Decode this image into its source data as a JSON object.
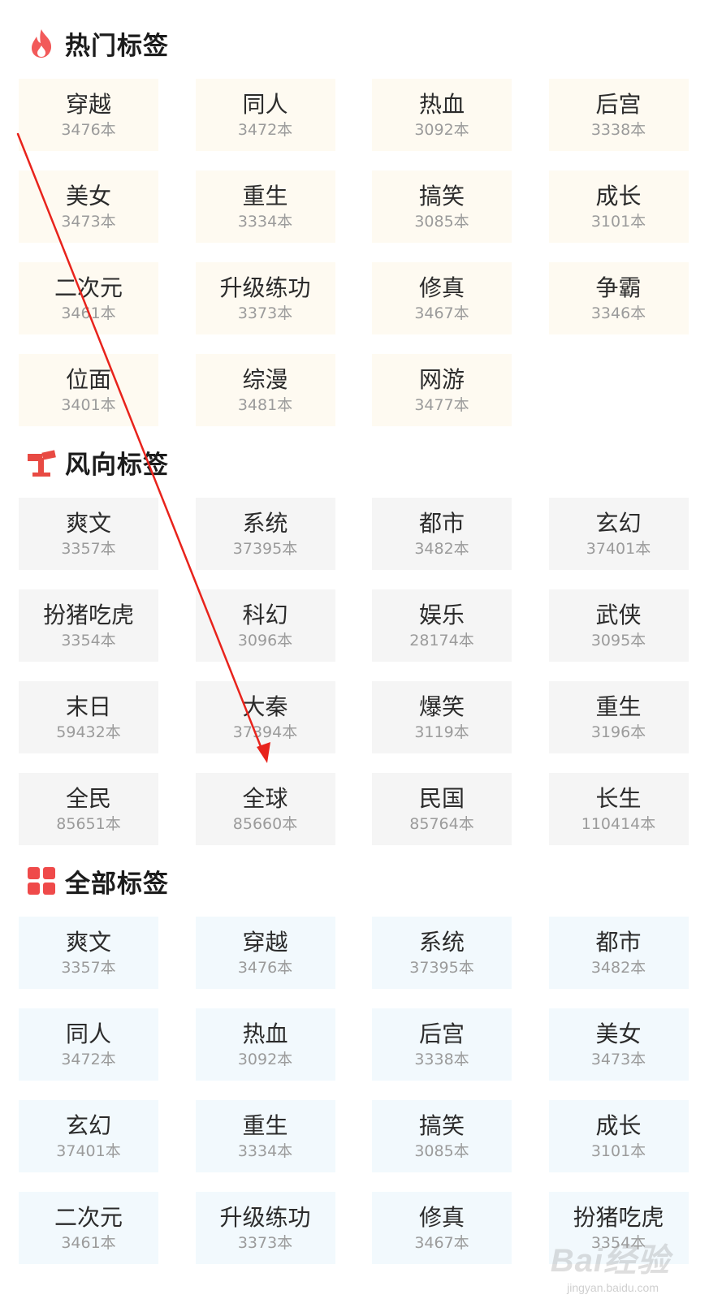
{
  "hot": {
    "title": "热门标签",
    "tags": [
      {
        "name": "穿越",
        "count": "3476本"
      },
      {
        "name": "同人",
        "count": "3472本"
      },
      {
        "name": "热血",
        "count": "3092本"
      },
      {
        "name": "后宫",
        "count": "3338本"
      },
      {
        "name": "美女",
        "count": "3473本"
      },
      {
        "name": "重生",
        "count": "3334本"
      },
      {
        "name": "搞笑",
        "count": "3085本"
      },
      {
        "name": "成长",
        "count": "3101本"
      },
      {
        "name": "二次元",
        "count": "3461本"
      },
      {
        "name": "升级练功",
        "count": "3373本"
      },
      {
        "name": "修真",
        "count": "3467本"
      },
      {
        "name": "争霸",
        "count": "3346本"
      },
      {
        "name": "位面",
        "count": "3401本"
      },
      {
        "name": "综漫",
        "count": "3481本"
      },
      {
        "name": "网游",
        "count": "3477本"
      }
    ]
  },
  "trend": {
    "title": "风向标签",
    "tags": [
      {
        "name": "爽文",
        "count": "3357本"
      },
      {
        "name": "系统",
        "count": "37395本"
      },
      {
        "name": "都市",
        "count": "3482本"
      },
      {
        "name": "玄幻",
        "count": "37401本"
      },
      {
        "name": "扮猪吃虎",
        "count": "3354本"
      },
      {
        "name": "科幻",
        "count": "3096本"
      },
      {
        "name": "娱乐",
        "count": "28174本"
      },
      {
        "name": "武侠",
        "count": "3095本"
      },
      {
        "name": "末日",
        "count": "59432本"
      },
      {
        "name": "大秦",
        "count": "37394本"
      },
      {
        "name": "爆笑",
        "count": "3119本"
      },
      {
        "name": "重生",
        "count": "3196本"
      },
      {
        "name": "全民",
        "count": "85651本"
      },
      {
        "name": "全球",
        "count": "85660本"
      },
      {
        "name": "民国",
        "count": "85764本"
      },
      {
        "name": "长生",
        "count": "110414本"
      }
    ]
  },
  "all": {
    "title": "全部标签",
    "tags": [
      {
        "name": "爽文",
        "count": "3357本"
      },
      {
        "name": "穿越",
        "count": "3476本"
      },
      {
        "name": "系统",
        "count": "37395本"
      },
      {
        "name": "都市",
        "count": "3482本"
      },
      {
        "name": "同人",
        "count": "3472本"
      },
      {
        "name": "热血",
        "count": "3092本"
      },
      {
        "name": "后宫",
        "count": "3338本"
      },
      {
        "name": "美女",
        "count": "3473本"
      },
      {
        "name": "玄幻",
        "count": "37401本"
      },
      {
        "name": "重生",
        "count": "3334本"
      },
      {
        "name": "搞笑",
        "count": "3085本"
      },
      {
        "name": "成长",
        "count": "3101本"
      },
      {
        "name": "二次元",
        "count": "3461本"
      },
      {
        "name": "升级练功",
        "count": "3373本"
      },
      {
        "name": "修真",
        "count": "3467本"
      },
      {
        "name": "扮猪吃虎",
        "count": "3354本"
      }
    ]
  },
  "watermark": {
    "text": "Bai经验",
    "sub": "jingyan.baidu.com"
  },
  "colors": {
    "hot_icon": "#f25a5a",
    "trend_icon": "#e84a43",
    "all_icon": "#ef4a4a",
    "arrow": "#e8231c"
  },
  "icons": {
    "hot": "flame-icon",
    "trend": "signpost-icon",
    "all": "grid-icon"
  }
}
